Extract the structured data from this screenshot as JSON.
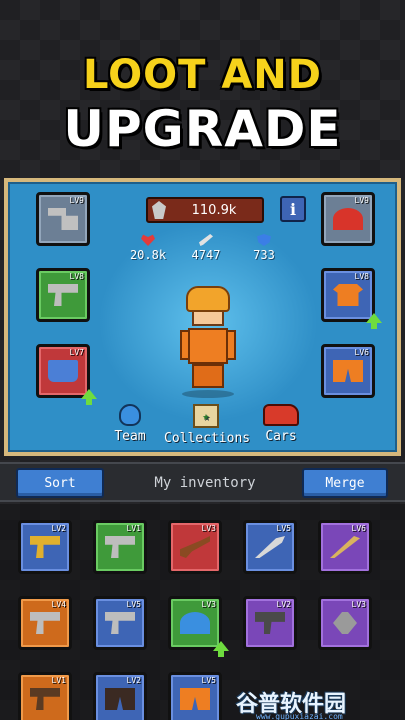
{
  "headline": {
    "line1": "LOOT AND",
    "line2": "UPGRADE"
  },
  "power": {
    "value": "110.9k"
  },
  "info_label": "i",
  "stats": [
    {
      "icon": "heart-icon",
      "value": "20.8k"
    },
    {
      "icon": "sword-icon",
      "value": "4747"
    },
    {
      "icon": "shield-icon",
      "value": "733"
    }
  ],
  "equipped": {
    "left": [
      {
        "name": "axe",
        "level": "LV9",
        "rarity": "grey"
      },
      {
        "name": "pistol",
        "level": "LV8",
        "rarity": "green"
      },
      {
        "name": "mug",
        "level": "LV7",
        "rarity": "red",
        "upgrade": true
      }
    ],
    "right": [
      {
        "name": "hat",
        "level": "LV9",
        "rarity": "grey"
      },
      {
        "name": "shirt",
        "level": "LV8",
        "rarity": "blue",
        "upgrade": true
      },
      {
        "name": "pants",
        "level": "LV6",
        "rarity": "blue"
      }
    ]
  },
  "nav": {
    "team": "Team",
    "collections": "Collections",
    "cars": "Cars"
  },
  "inventory_bar": {
    "sort": "Sort",
    "title": "My inventory",
    "merge": "Merge"
  },
  "inventory": [
    [
      {
        "item": "nailgun",
        "level": "LV2",
        "rarity": "blue"
      },
      {
        "item": "pistol",
        "level": "LV1",
        "rarity": "green"
      },
      {
        "item": "shotgun",
        "level": "LV3",
        "rarity": "red"
      },
      {
        "item": "machete",
        "level": "LV5",
        "rarity": "blue"
      },
      {
        "item": "bat",
        "level": "LV6",
        "rarity": "purple"
      }
    ],
    [
      {
        "item": "pistol",
        "level": "LV4",
        "rarity": "orange"
      },
      {
        "item": "pistol",
        "level": "LV5",
        "rarity": "blue"
      },
      {
        "item": "cap",
        "level": "LV3",
        "rarity": "green",
        "upgrade": true
      },
      {
        "item": "smg",
        "level": "LV2",
        "rarity": "purple"
      },
      {
        "item": "trowel",
        "level": "LV3",
        "rarity": "purple"
      }
    ],
    [
      {
        "item": "revolver",
        "level": "LV1",
        "rarity": "orange"
      },
      {
        "item": "pants",
        "level": "LV2",
        "rarity": "blue"
      },
      {
        "item": "pants",
        "level": "LV5",
        "rarity": "blue"
      }
    ]
  ],
  "watermark": {
    "main": "谷普软件园",
    "sub": "www.gupuxiazai.com"
  }
}
